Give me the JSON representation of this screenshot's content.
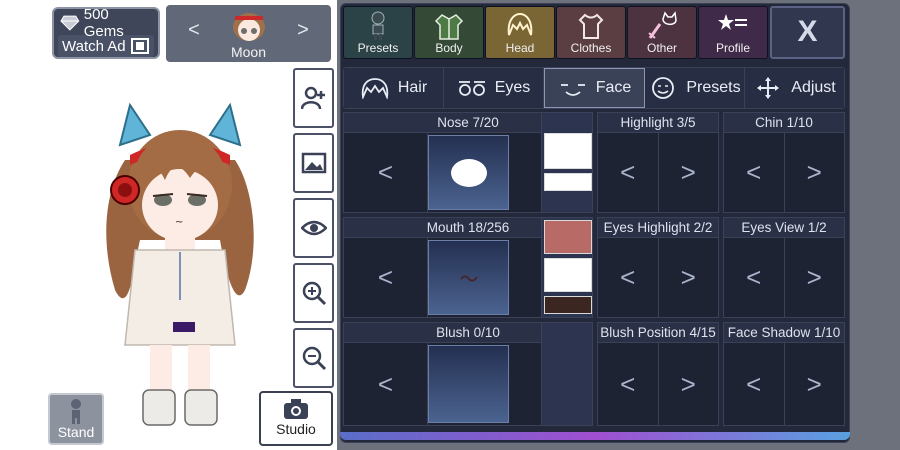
{
  "currency": {
    "gems_label": "500 Gems",
    "watch_ad_label": "Watch Ad"
  },
  "character_select": {
    "prev": "<",
    "next": ">",
    "name": "Moon"
  },
  "left_buttons": {
    "stand_label": "Stand",
    "studio_label": "Studio"
  },
  "top_tabs": [
    {
      "label": "Presets",
      "icon": "figure-icon"
    },
    {
      "label": "Body",
      "icon": "jacket-icon"
    },
    {
      "label": "Head",
      "icon": "hair-icon"
    },
    {
      "label": "Clothes",
      "icon": "shirt-icon"
    },
    {
      "label": "Other",
      "icon": "sword-cat-icon"
    },
    {
      "label": "Profile",
      "icon": "star-list-icon"
    }
  ],
  "close_label": "X",
  "sub_tabs": [
    {
      "label": "Hair"
    },
    {
      "label": "Eyes"
    },
    {
      "label": "Face"
    },
    {
      "label": "Presets"
    },
    {
      "label": "Adjust"
    }
  ],
  "sections": {
    "nose": "Nose 7/20",
    "mouth": "Mouth 18/256",
    "blush": "Blush 0/10",
    "highlight": "Highlight 3/5",
    "chin": "Chin 1/10",
    "eyes_highlight": "Eyes Highlight 2/2",
    "eyes_view": "Eyes View 1/2",
    "blush_position": "Blush Position 4/15",
    "face_shadow": "Face Shadow 1/10"
  },
  "arrows": {
    "left": "<",
    "right": ">"
  },
  "colors": {
    "mouth_color": "#b86a66",
    "shade_color": "#3b2622",
    "accent_active_tab": "#7a6634"
  }
}
